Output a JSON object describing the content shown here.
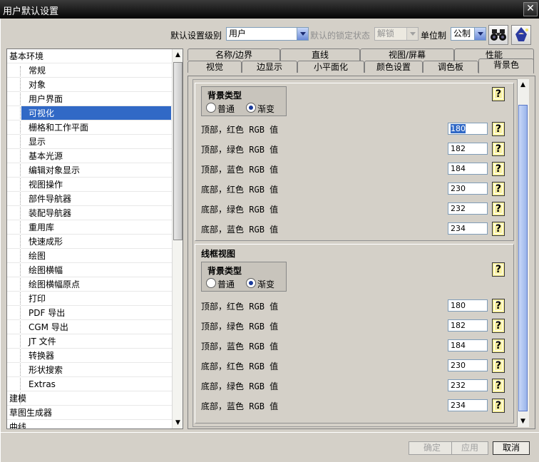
{
  "window": {
    "title": "用户默认设置",
    "close_label": "✕"
  },
  "toolbar": {
    "level_label": "默认设置级别",
    "level_value": "用户",
    "lock_label": "默认的锁定状态",
    "lock_value": "解锁",
    "unit_label": "单位制",
    "unit_value": "公制"
  },
  "tree": {
    "items": [
      {
        "label": "基本环境",
        "kind": "root"
      },
      {
        "label": "常规",
        "kind": "sub"
      },
      {
        "label": "对象",
        "kind": "sub"
      },
      {
        "label": "用户界面",
        "kind": "sub"
      },
      {
        "label": "可视化",
        "kind": "sub",
        "selected": true
      },
      {
        "label": "栅格和工作平面",
        "kind": "sub"
      },
      {
        "label": "显示",
        "kind": "sub"
      },
      {
        "label": "基本光源",
        "kind": "sub"
      },
      {
        "label": "编辑对象显示",
        "kind": "sub"
      },
      {
        "label": "视图操作",
        "kind": "sub"
      },
      {
        "label": "部件导航器",
        "kind": "sub"
      },
      {
        "label": "装配导航器",
        "kind": "sub"
      },
      {
        "label": "重用库",
        "kind": "sub"
      },
      {
        "label": "快速成形",
        "kind": "sub"
      },
      {
        "label": "绘图",
        "kind": "sub"
      },
      {
        "label": "绘图横幅",
        "kind": "sub"
      },
      {
        "label": "绘图横幅原点",
        "kind": "sub"
      },
      {
        "label": "打印",
        "kind": "sub"
      },
      {
        "label": "PDF 导出",
        "kind": "sub"
      },
      {
        "label": "CGM 导出",
        "kind": "sub"
      },
      {
        "label": "JT 文件",
        "kind": "sub"
      },
      {
        "label": "转换器",
        "kind": "sub"
      },
      {
        "label": "形状搜索",
        "kind": "sub"
      },
      {
        "label": "Extras",
        "kind": "sub"
      },
      {
        "label": "建模",
        "kind": "root"
      },
      {
        "label": "草图生成器",
        "kind": "root"
      },
      {
        "label": "曲线",
        "kind": "root"
      }
    ]
  },
  "tabs": {
    "row1": [
      "名称/边界",
      "直线",
      "视图/屏幕",
      "性能"
    ],
    "row2": [
      "视觉",
      "边显示",
      "小平面化",
      "颜色设置",
      "调色板",
      "背景色"
    ],
    "active": "背景色"
  },
  "shaded": {
    "bg_type_label": "背景类型",
    "opt_plain": "普通",
    "opt_gradient": "渐变",
    "selected": "渐变",
    "rows": [
      {
        "label_cjk": "顶部，红色",
        "label_code": "RGB",
        "label_end": "值",
        "value": "180"
      },
      {
        "label_cjk": "顶部，绿色",
        "label_code": "RGB",
        "label_end": "值",
        "value": "182"
      },
      {
        "label_cjk": "顶部，蓝色",
        "label_code": "RGB",
        "label_end": "值",
        "value": "184"
      },
      {
        "label_cjk": "底部，红色",
        "label_code": "RGB",
        "label_end": "值",
        "value": "230"
      },
      {
        "label_cjk": "底部，绿色",
        "label_code": "RGB",
        "label_end": "值",
        "value": "232"
      },
      {
        "label_cjk": "底部，蓝色",
        "label_code": "RGB",
        "label_end": "值",
        "value": "234"
      }
    ]
  },
  "wireframe": {
    "title": "线框视图",
    "bg_type_label": "背景类型",
    "opt_plain": "普通",
    "opt_gradient": "渐变",
    "selected": "渐变",
    "rows": [
      {
        "label_cjk": "顶部，红色",
        "label_code": "RGB",
        "label_end": "值",
        "value": "180"
      },
      {
        "label_cjk": "顶部，绿色",
        "label_code": "RGB",
        "label_end": "值",
        "value": "182"
      },
      {
        "label_cjk": "顶部，蓝色",
        "label_code": "RGB",
        "label_end": "值",
        "value": "184"
      },
      {
        "label_cjk": "底部，红色",
        "label_code": "RGB",
        "label_end": "值",
        "value": "230"
      },
      {
        "label_cjk": "底部，绿色",
        "label_code": "RGB",
        "label_end": "值",
        "value": "232"
      },
      {
        "label_cjk": "底部，蓝色",
        "label_code": "RGB",
        "label_end": "值",
        "value": "234"
      }
    ]
  },
  "help_glyph": "?",
  "buttons": {
    "ok": "确定",
    "apply": "应用",
    "cancel": "取消"
  },
  "icons": {
    "find": "binoculars-icon",
    "help": "wizard-help-icon"
  },
  "colors": {
    "selection": "#3169c6",
    "help_bg": "#f8f0a0",
    "title_bg": "#050505"
  }
}
